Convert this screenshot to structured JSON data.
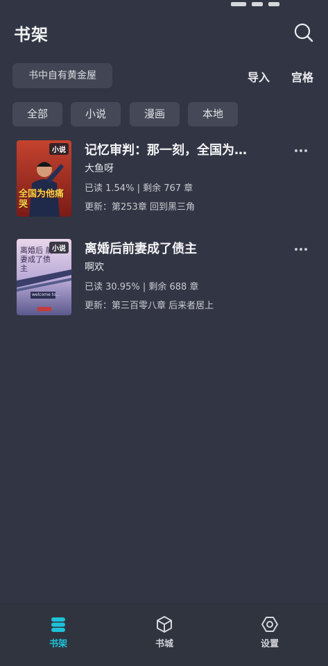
{
  "header": {
    "title": "书架"
  },
  "top_row": {
    "motto": "书中自有黄金屋",
    "import_label": "导入",
    "grid_label": "宫格"
  },
  "tabs": [
    {
      "label": "全部"
    },
    {
      "label": "小说"
    },
    {
      "label": "漫画"
    },
    {
      "label": "本地"
    }
  ],
  "books": [
    {
      "title": "记忆审判：那一刻，全国为…",
      "author": "大鱼呀",
      "progress": "已读 1.54% | 剩余 767 章",
      "update": "更新：第253章 回到黑三角",
      "badge": "小说",
      "cover_text": "全国为他痛哭"
    },
    {
      "title": "离婚后前妻成了债主",
      "author": "啊欢",
      "progress": "已读 30.95% | 剩余 688 章",
      "update": "更新：第三百零八章 后来者居上",
      "badge": "小说",
      "cover_text": "离婚后 前妻成了债主",
      "cover_sign": "welcome to..."
    }
  ],
  "bottom_nav": [
    {
      "label": "书架",
      "icon": "bookshelf-icon",
      "active": true
    },
    {
      "label": "书城",
      "icon": "cube-icon",
      "active": false
    },
    {
      "label": "设置",
      "icon": "hexagon-settings-icon",
      "active": false
    }
  ],
  "colors": {
    "background": "#323644",
    "accent": "#1ec2d8",
    "chip": "#454957"
  }
}
